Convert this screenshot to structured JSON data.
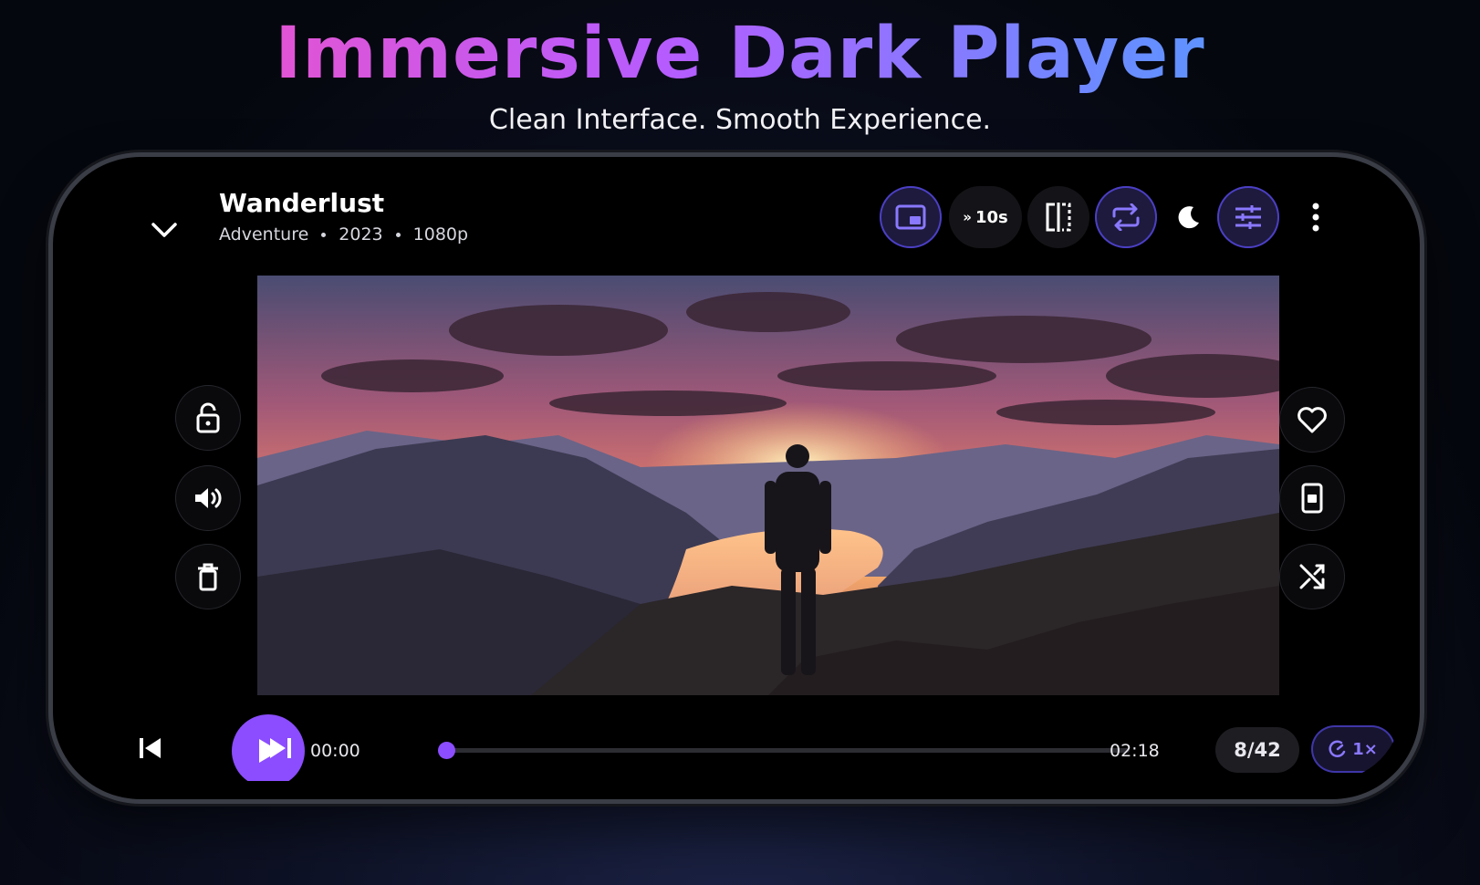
{
  "headline": "Immersive Dark Player",
  "subline": "Clean Interface. Smooth Experience.",
  "video": {
    "title": "Wanderlust",
    "genre": "Adventure",
    "year": "2023",
    "quality": "1080p"
  },
  "toolbar": {
    "pip_icon": "picture-in-picture-icon",
    "skip_label": "10s",
    "split_icon": "mirror-icon",
    "repeat_icon": "repeat-icon",
    "night_icon": "moon-icon",
    "equalizer_icon": "sliders-icon",
    "more_icon": "more-vertical-icon"
  },
  "left_controls": [
    "lock-icon",
    "volume-icon",
    "trash-icon"
  ],
  "right_controls": [
    "heart-icon",
    "portrait-lock-icon",
    "shuffle-icon"
  ],
  "playback": {
    "current_time": "00:00",
    "total_time": "02:18",
    "progress": 0,
    "counter": "8/42",
    "speed": "1×"
  },
  "colors": {
    "accent": "#8b4dff",
    "accent_border": "#4b3fc4",
    "background": "#000000"
  }
}
